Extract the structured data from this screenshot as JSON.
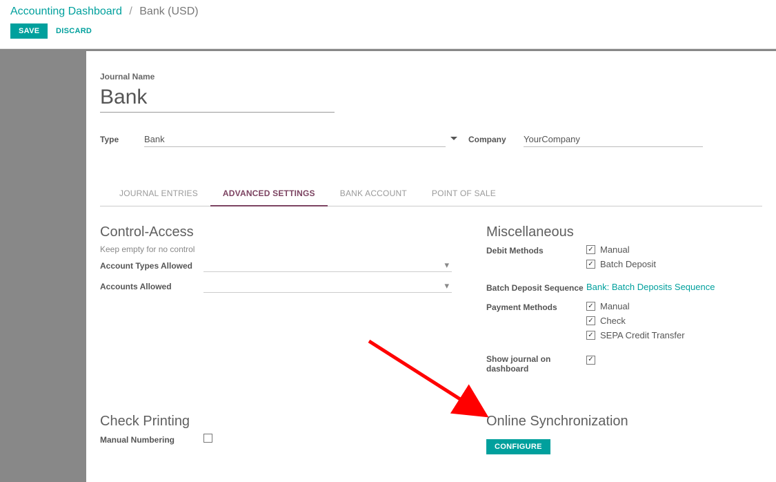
{
  "breadcrumb": {
    "root": "Accounting Dashboard",
    "current": "Bank (USD)"
  },
  "actions": {
    "save": "Save",
    "discard": "Discard"
  },
  "journal": {
    "name_label": "Journal Name",
    "name_value": "Bank"
  },
  "top_fields": {
    "type_label": "Type",
    "type_value": "Bank",
    "company_label": "Company",
    "company_value": "YourCompany"
  },
  "tabs": {
    "journal_entries": "Journal Entries",
    "advanced_settings": "Advanced Settings",
    "bank_account": "Bank Account",
    "point_of_sale": "Point of Sale"
  },
  "control_access": {
    "title": "Control-Access",
    "hint": "Keep empty for no control",
    "account_types_allowed": "Account Types Allowed",
    "accounts_allowed": "Accounts Allowed"
  },
  "misc": {
    "title": "Miscellaneous",
    "debit_methods": "Debit Methods",
    "debit_manual": "Manual",
    "debit_batch": "Batch Deposit",
    "batch_seq_label": "Batch Deposit Sequence",
    "batch_seq_value": "Bank: Batch Deposits Sequence",
    "payment_methods": "Payment Methods",
    "pay_manual": "Manual",
    "pay_check": "Check",
    "pay_sepa": "SEPA Credit Transfer",
    "show_dash": "Show journal on dashboard"
  },
  "check_printing": {
    "title": "Check Printing",
    "manual_numbering": "Manual Numbering"
  },
  "online_sync": {
    "title": "Online Synchronization",
    "configure": "Configure"
  }
}
